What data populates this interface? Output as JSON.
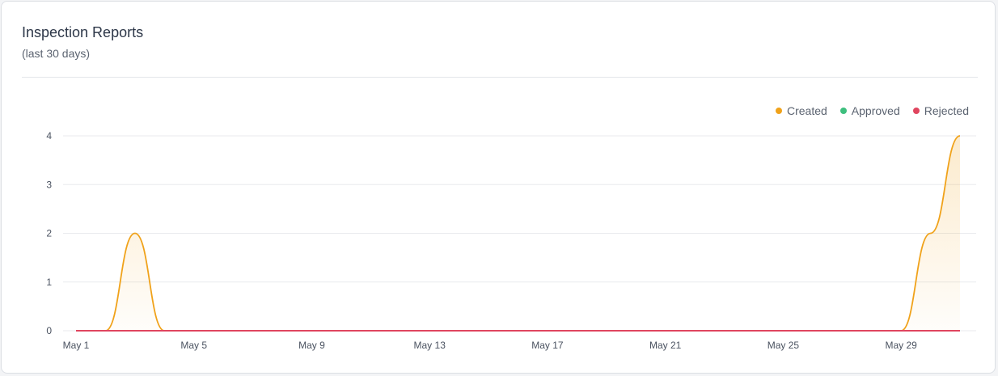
{
  "header": {
    "title": "Inspection Reports",
    "subtitle": "(last 30 days)"
  },
  "colors": {
    "created": "#f0a21a",
    "approved": "#3dbf7e",
    "rejected": "#e0455f",
    "grid": "#e8eaed"
  },
  "chart_data": {
    "type": "area",
    "title": "Inspection Reports",
    "subtitle": "(last 30 days)",
    "xlabel": "",
    "ylabel": "",
    "x": [
      "May 1",
      "May 2",
      "May 3",
      "May 4",
      "May 5",
      "May 6",
      "May 7",
      "May 8",
      "May 9",
      "May 10",
      "May 11",
      "May 12",
      "May 13",
      "May 14",
      "May 15",
      "May 16",
      "May 17",
      "May 18",
      "May 19",
      "May 20",
      "May 21",
      "May 22",
      "May 23",
      "May 24",
      "May 25",
      "May 26",
      "May 27",
      "May 28",
      "May 29",
      "May 30",
      "May 31"
    ],
    "x_tick_labels": [
      "May 1",
      "May 5",
      "May 9",
      "May 13",
      "May 17",
      "May 21",
      "May 25",
      "May 29"
    ],
    "ylim": [
      0,
      4
    ],
    "y_ticks": [
      0,
      1,
      2,
      3,
      4
    ],
    "grid": true,
    "legend_position": "top-right",
    "series": [
      {
        "name": "Created",
        "color": "#f0a21a",
        "values": [
          0,
          0,
          2,
          0,
          0,
          0,
          0,
          0,
          0,
          0,
          0,
          0,
          0,
          0,
          0,
          0,
          0,
          0,
          0,
          0,
          0,
          0,
          0,
          0,
          0,
          0,
          0,
          0,
          0,
          2,
          4
        ]
      },
      {
        "name": "Approved",
        "color": "#3dbf7e",
        "values": [
          0,
          0,
          0,
          0,
          0,
          0,
          0,
          0,
          0,
          0,
          0,
          0,
          0,
          0,
          0,
          0,
          0,
          0,
          0,
          0,
          0,
          0,
          0,
          0,
          0,
          0,
          0,
          0,
          0,
          0,
          0
        ]
      },
      {
        "name": "Rejected",
        "color": "#e0455f",
        "values": [
          0,
          0,
          0,
          0,
          0,
          0,
          0,
          0,
          0,
          0,
          0,
          0,
          0,
          0,
          0,
          0,
          0,
          0,
          0,
          0,
          0,
          0,
          0,
          0,
          0,
          0,
          0,
          0,
          0,
          0,
          0
        ]
      }
    ]
  }
}
